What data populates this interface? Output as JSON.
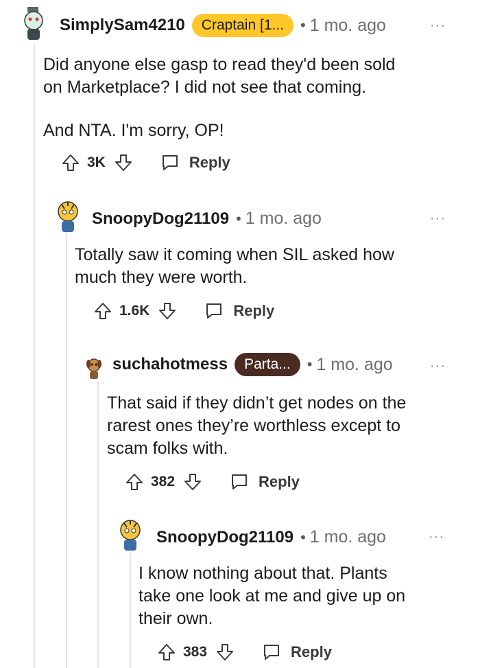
{
  "comments": [
    {
      "username": "SimplySam4210",
      "flair": "Craptain [1...",
      "time": "1 mo. ago",
      "more": "···",
      "body_lines": [
        "Did anyone else gasp to read they'd been sold",
        "on Marketplace? I did not see that coming.",
        "",
        "And NTA. I'm sorry, OP!"
      ],
      "votes": "3K",
      "reply_label": "Reply"
    },
    {
      "username": "SnoopyDog21109",
      "time": "1 mo. ago",
      "more": "···",
      "body_lines": [
        "Totally saw it coming when SIL asked how",
        "much they were worth."
      ],
      "votes": "1.6K",
      "reply_label": "Reply"
    },
    {
      "username": "suchahotmess",
      "flair": "Parta...",
      "time": "1 mo. ago",
      "more": "···",
      "body_lines": [
        "That said if they didn’t get nodes on the",
        "rarest ones they’re worthless except to",
        "scam folks with."
      ],
      "votes": "382",
      "reply_label": "Reply"
    },
    {
      "username": "SnoopyDog21109",
      "time": "1 mo. ago",
      "more": "···",
      "body_lines": [
        "I know nothing about that. Plants",
        "take one look at me and give up on",
        "their own."
      ],
      "votes": "383",
      "reply_label": "Reply"
    }
  ],
  "separator": "•",
  "colors": {
    "flair_yellow": "#ffc72a",
    "flair_brown": "#4a2b22",
    "thread_line": "#e3e3e3"
  }
}
